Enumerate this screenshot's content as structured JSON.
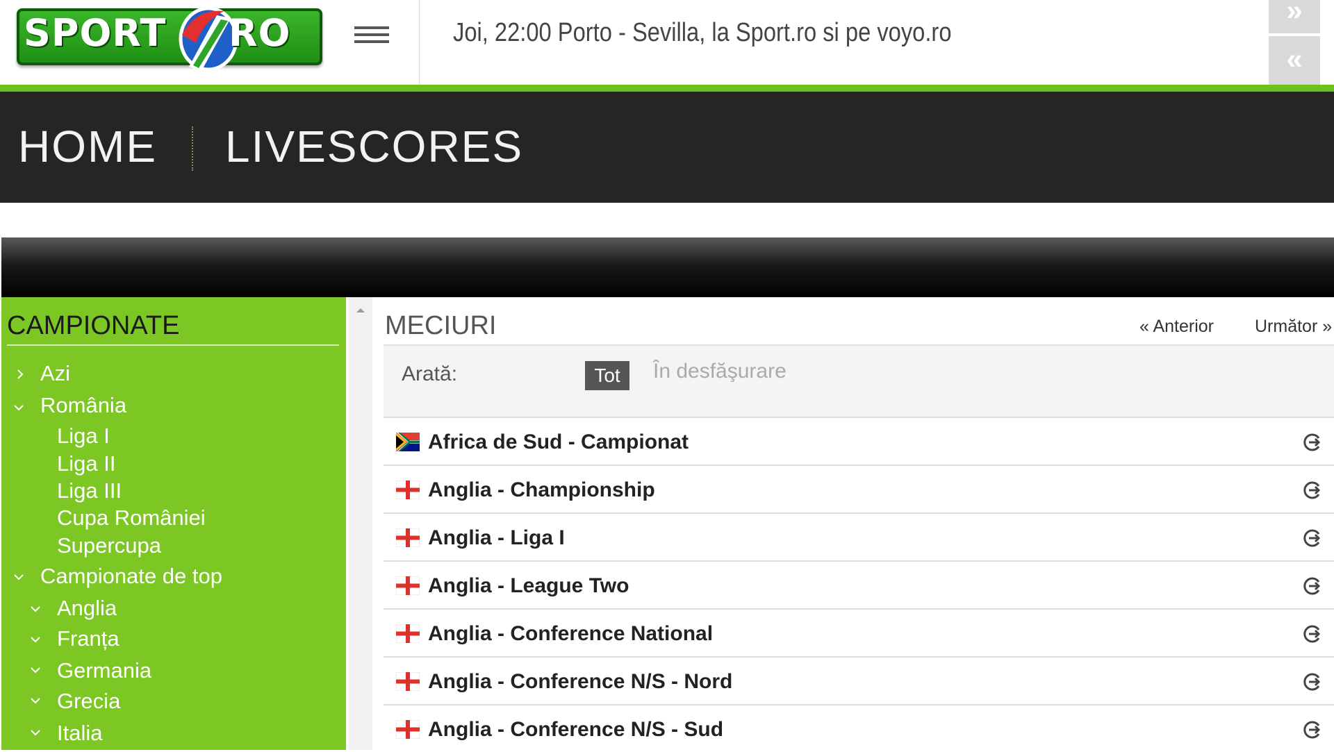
{
  "header": {
    "logo": "SPORT.RO",
    "logo_left": "SPORT",
    "logo_right": "RO",
    "ticker_text": "Joi, 22:00 Porto - Sevilla, la Sport.ro si pe voyo.ro",
    "ticker_next": "»",
    "ticker_prev": "«"
  },
  "nav": {
    "items": [
      {
        "label": "HOME"
      },
      {
        "label": "LIVESCORES"
      }
    ]
  },
  "sidebar": {
    "title": "CAMPIONATE",
    "items": [
      {
        "label": "Azi",
        "icon": "chevron-right-icon"
      },
      {
        "label": "România",
        "icon": "chevron-down-icon"
      },
      {
        "label": "Liga I"
      },
      {
        "label": "Liga II"
      },
      {
        "label": "Liga III"
      },
      {
        "label": "Cupa României"
      },
      {
        "label": "Supercupa"
      },
      {
        "label": "Campionate de top",
        "icon": "chevron-down-icon"
      },
      {
        "label": "Anglia",
        "icon": "chevron-down-icon"
      },
      {
        "label": "Franța",
        "icon": "chevron-down-icon"
      },
      {
        "label": "Germania",
        "icon": "chevron-down-icon"
      },
      {
        "label": "Grecia",
        "icon": "chevron-down-icon"
      },
      {
        "label": "Italia",
        "icon": "chevron-down-icon"
      }
    ]
  },
  "main": {
    "title": "MECIURI",
    "pager_prev": "« Anterior",
    "pager_next": "Următor »",
    "filter": {
      "label": "Arată:",
      "options": [
        {
          "label": "Tot",
          "selected": true
        },
        {
          "label": "În desfăşurare",
          "selected": false
        }
      ]
    },
    "leagues": [
      {
        "name": "Africa de Sud - Campionat",
        "flag": "south-africa-flag-icon"
      },
      {
        "name": "Anglia - Championship",
        "flag": "england-flag-icon"
      },
      {
        "name": "Anglia - Liga I",
        "flag": "england-flag-icon"
      },
      {
        "name": "Anglia - League Two",
        "flag": "england-flag-icon"
      },
      {
        "name": "Anglia - Conference National",
        "flag": "england-flag-icon"
      },
      {
        "name": "Anglia - Conference N/S - Nord",
        "flag": "england-flag-icon"
      },
      {
        "name": "Anglia - Conference N/S - Sud",
        "flag": "england-flag-icon"
      }
    ]
  },
  "colors": {
    "accent_green": "#7dc724",
    "nav_dark": "#252525",
    "header_rule": "#6cc21a"
  }
}
